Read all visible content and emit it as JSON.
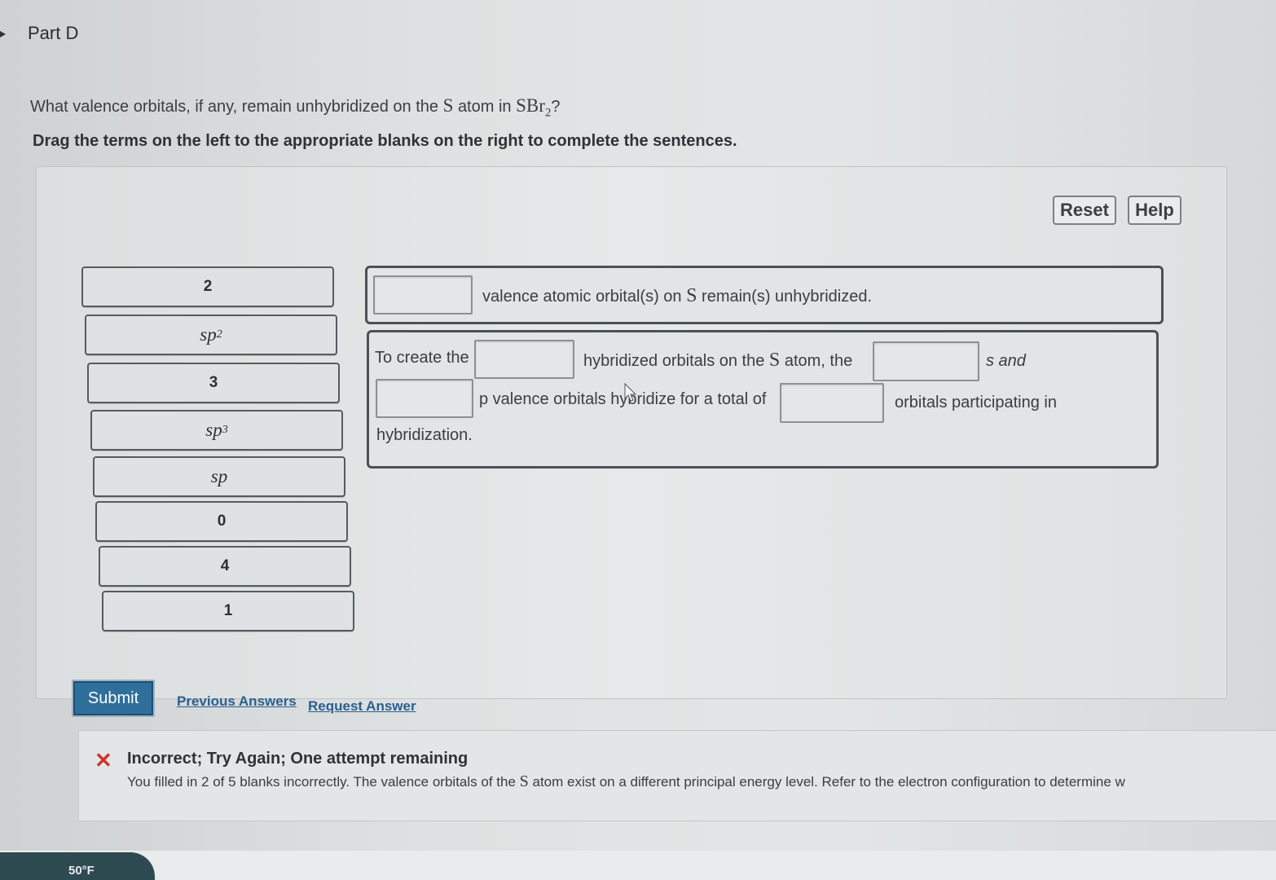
{
  "part": {
    "title": "Part D"
  },
  "question": {
    "prefix": "What valence orbitals, if any, remain unhybridized on the",
    "atom": "S",
    "middle": "atom in",
    "formula_main": "SBr",
    "formula_sub": "2",
    "suffix": "?"
  },
  "instructions": "Drag the terms on the left to the appropriate blanks on the right to complete the sentences.",
  "toolbar": {
    "reset_label": "Reset",
    "help_label": "Help"
  },
  "terms": [
    {
      "base": "2",
      "sup": ""
    },
    {
      "base": "sp",
      "sup": "2"
    },
    {
      "base": "3",
      "sup": ""
    },
    {
      "base": "sp",
      "sup": "3"
    },
    {
      "base": "sp",
      "sup": ""
    },
    {
      "base": "0",
      "sup": ""
    },
    {
      "base": "4",
      "sup": ""
    },
    {
      "base": "1",
      "sup": ""
    }
  ],
  "sentence1": {
    "text_a": "valence atomic orbital(s) on",
    "atom": "S",
    "text_b": "remain(s) unhybridized."
  },
  "sentence2": {
    "to_create": "To create the",
    "hybridized_text": "hybridized orbitals on the",
    "atom": "S",
    "atom_the": "atom, the",
    "s_and": "s and",
    "p_valence": "p valence orbitals hybridize for a total of",
    "orbitals_participating": "orbitals participating in",
    "hybridization": "hybridization."
  },
  "actions": {
    "submit_label": "Submit",
    "previous_answers": "Previous Answers",
    "request_answer": "Request Answer"
  },
  "feedback": {
    "icon": "x-icon",
    "title": "Incorrect; Try Again; One attempt remaining",
    "msg_a": "You filled in 2 of 5 blanks incorrectly. The valence orbitals of the",
    "atom": "S",
    "msg_b": "atom exist on a different principal energy level. Refer to the electron configuration to determine w",
    "error_color": "#d0342c"
  },
  "taskbar": {
    "weather": "50°F"
  }
}
